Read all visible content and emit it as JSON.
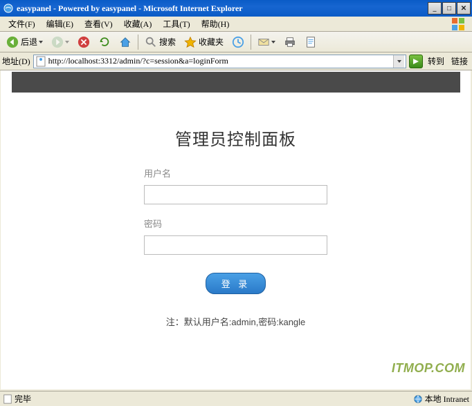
{
  "window": {
    "title": "easypanel - Powered by easypanel - Microsoft Internet Explorer"
  },
  "menu": {
    "file": "文件(F)",
    "edit": "编辑(E)",
    "view": "查看(V)",
    "favorites": "收藏(A)",
    "tools": "工具(T)",
    "help": "帮助(H)"
  },
  "toolbar": {
    "back": "后退",
    "search": "搜索",
    "favorites": "收藏夹"
  },
  "address": {
    "label": "地址(D)",
    "url": "http://localhost:3312/admin/?c=session&a=loginForm",
    "go": "转到",
    "links": "链接"
  },
  "page": {
    "heading": "管理员控制面板",
    "username_label": "用户名",
    "password_label": "密码",
    "login_label": "登 录",
    "note": "注：默认用户名:admin,密码:kangle"
  },
  "status": {
    "done": "完毕",
    "zone": "本地 Intranet"
  },
  "watermark": "ITMOP.COM"
}
